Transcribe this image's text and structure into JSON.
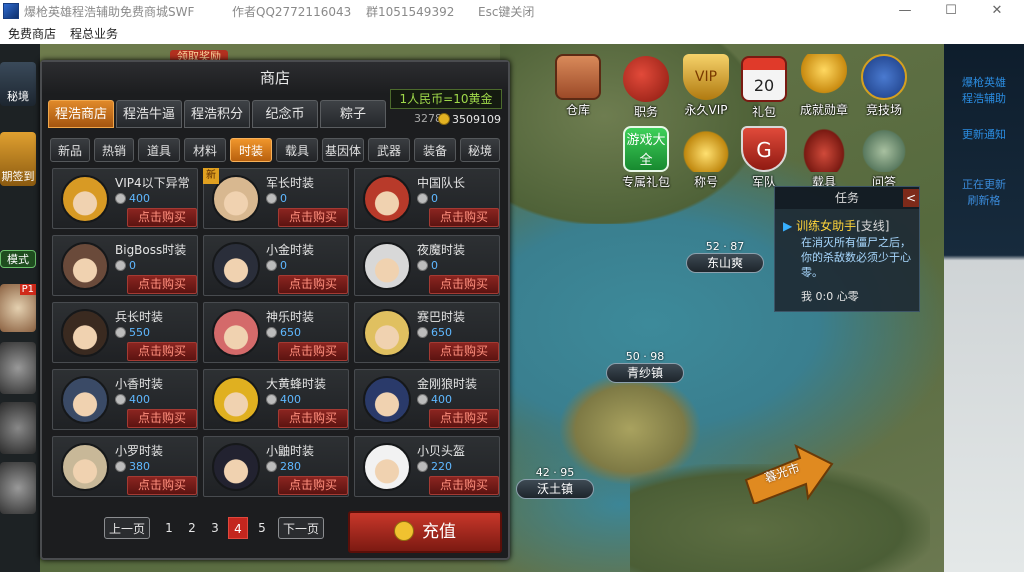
{
  "titlebar": {
    "app": "爆枪英雄程浩辅助免费商城SWF",
    "qq": "作者QQ2772116043",
    "group": "群1051549392",
    "esc": "Esc键关闭",
    "min": "—",
    "max": "☐",
    "close": "✕"
  },
  "menu": [
    "免费商店",
    "程总业务"
  ],
  "left_strip": {
    "items": [
      "秘境",
      "期签到",
      "模式",
      "P1"
    ]
  },
  "right_panel": {
    "line1": "爆枪英雄",
    "line2": "程浩辅助",
    "line3": "更新通知",
    "line4": "正在更新",
    "line5": "刷新格"
  },
  "top_map_label": "领取奖励",
  "shop": {
    "title": "商店",
    "rate": "1人民币=10黄金",
    "partial_left": "3278",
    "gold": "3509109",
    "main_tabs": [
      {
        "label": "程浩商店",
        "active": true
      },
      {
        "label": "程浩牛逼",
        "active": false
      },
      {
        "label": "程浩积分",
        "active": false
      },
      {
        "label": "纪念币",
        "active": false
      },
      {
        "label": "粽子",
        "active": false
      }
    ],
    "sub_tabs": [
      {
        "label": "新品",
        "active": false
      },
      {
        "label": "热销",
        "active": false
      },
      {
        "label": "道具",
        "active": false
      },
      {
        "label": "材料",
        "active": false
      },
      {
        "label": "时装",
        "active": true
      },
      {
        "label": "载具",
        "active": false
      },
      {
        "label": "基因体",
        "active": false
      },
      {
        "label": "武器",
        "active": false
      },
      {
        "label": "装备",
        "active": false
      },
      {
        "label": "秘境",
        "active": false
      }
    ],
    "buy_label": "点击购买",
    "new_tag": "新",
    "items": [
      {
        "name": "VIP4以下异常",
        "price": "400",
        "color": "#d89a24",
        "is_new": false
      },
      {
        "name": "军长时装",
        "price": "0",
        "color": "#d8b890",
        "is_new": true
      },
      {
        "name": "中国队长",
        "price": "0",
        "color": "#b83a2a",
        "is_new": false
      },
      {
        "name": "BigBoss时装",
        "price": "0",
        "color": "#6a4a3a",
        "is_new": false
      },
      {
        "name": "小金时装",
        "price": "0",
        "color": "#2a2e3a",
        "is_new": false
      },
      {
        "name": "夜魔时装",
        "price": "0",
        "color": "#d8d8d8",
        "is_new": false
      },
      {
        "name": "兵长时装",
        "price": "550",
        "color": "#3a2a20",
        "is_new": false
      },
      {
        "name": "神乐时装",
        "price": "650",
        "color": "#d46a6a",
        "is_new": false
      },
      {
        "name": "赛巴时装",
        "price": "650",
        "color": "#e0c060",
        "is_new": false
      },
      {
        "name": "小香时装",
        "price": "400",
        "color": "#3a4a66",
        "is_new": false
      },
      {
        "name": "大黄蜂时装",
        "price": "400",
        "color": "#e0b020",
        "is_new": false
      },
      {
        "name": "金刚狼时装",
        "price": "400",
        "color": "#2a3a6a",
        "is_new": false
      },
      {
        "name": "小罗时装",
        "price": "380",
        "color": "#c8b898",
        "is_new": false
      },
      {
        "name": "小鼬时装",
        "price": "280",
        "color": "#222230",
        "is_new": false
      },
      {
        "name": "小贝头盔",
        "price": "220",
        "color": "#f2f2f2",
        "is_new": false
      }
    ],
    "pager": {
      "prev": "上一页",
      "next": "下一页",
      "pages": [
        "1",
        "2",
        "3",
        "4",
        "5"
      ],
      "current": "4"
    },
    "charge": "充值"
  },
  "game_icons": [
    {
      "label": "仓库",
      "color": "#b55a3a"
    },
    {
      "label": "职务",
      "color": "#c0392b"
    },
    {
      "label": "永久VIP",
      "color": "#d4a020"
    },
    {
      "label": "礼包",
      "color": "#c9302c"
    },
    {
      "label": "成就勋章",
      "color": "#e0a020"
    },
    {
      "label": "竞技场",
      "color": "#2c5aa0"
    },
    {
      "label": "专属礼包",
      "color": "#2aa040",
      "pic_text": "游戏大全"
    },
    {
      "label": "称号",
      "color": "#d4a020"
    },
    {
      "label": "军队",
      "color": "#c0302a",
      "pic_text": "G"
    },
    {
      "label": "载具",
      "color": "#b0302a"
    },
    {
      "label": "问答",
      "color": "#6a8a70"
    }
  ],
  "calendar_day": "20",
  "task": {
    "title": "任务",
    "close": "<",
    "quest": "训练女助手",
    "quest_type": "[支线]",
    "desc": "在消灭所有僵尸之后，你的杀敌数必须少于心零。",
    "progress": "我 0:0 心零"
  },
  "locations": [
    {
      "coord": "52 · 87",
      "name": "东山爽"
    },
    {
      "coord": "50 · 98",
      "name": "青纱镇"
    },
    {
      "coord": "42 · 95",
      "name": "沃土镇"
    }
  ],
  "arrow_label": "暮光市"
}
